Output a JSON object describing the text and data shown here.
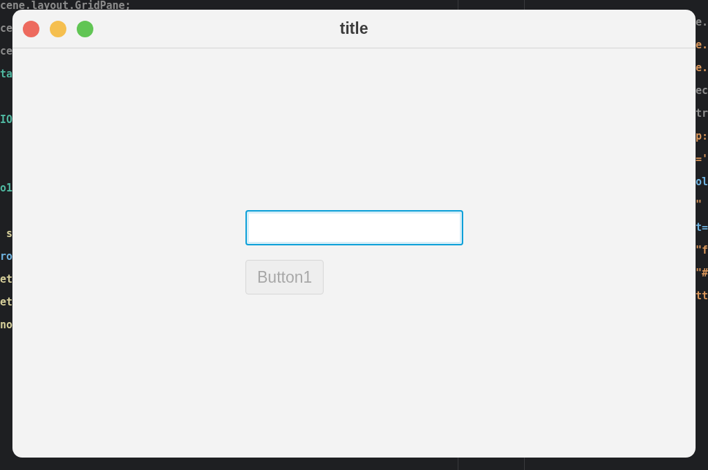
{
  "editor": {
    "left_lines": [
      {
        "text": "cene.layout.GridPane;",
        "color": "#8c8c8c"
      },
      {
        "text": "ce",
        "color": "#8c8c8c"
      },
      {
        "text": "ce",
        "color": "#8c8c8c"
      },
      {
        "text": "ta",
        "color": "#4fb7a0"
      },
      {
        "text": "IO",
        "color": "#4fb7a0"
      },
      {
        "text": "o1",
        "color": "#4fb7a0"
      },
      {
        "text": " s",
        "color": "#d6cf9a"
      },
      {
        "text": "ro",
        "color": "#6fb3e0"
      },
      {
        "text": "et",
        "color": "#d6cf9a"
      },
      {
        "text": "et",
        "color": "#d6cf9a"
      },
      {
        "text": "no",
        "color": "#d6cf9a"
      }
    ],
    "right_lines": [
      {
        "text": "e.",
        "color": "#8c8c8c"
      },
      {
        "text": "e.",
        "color": "#d7955b"
      },
      {
        "text": "e.",
        "color": "#d7955b"
      },
      {
        "text": "ec",
        "color": "#8c8c8c"
      },
      {
        "text": "tr",
        "color": "#8c8c8c"
      },
      {
        "text": "p:",
        "color": "#d7955b"
      },
      {
        "text": "='",
        "color": "#d7955b"
      },
      {
        "text": "ol",
        "color": "#6fb3e0"
      },
      {
        "text": "\"",
        "color": "#d7955b"
      },
      {
        "text": "t=",
        "color": "#6fb3e0"
      },
      {
        "text": "\"f",
        "color": "#d7955b"
      },
      {
        "text": "\"#",
        "color": "#d7955b"
      },
      {
        "text": "tt",
        "color": "#d7955b"
      }
    ]
  },
  "window": {
    "title": "title",
    "text_field": {
      "focused": true
    },
    "button": {
      "label": "Button1",
      "disabled": true
    }
  }
}
